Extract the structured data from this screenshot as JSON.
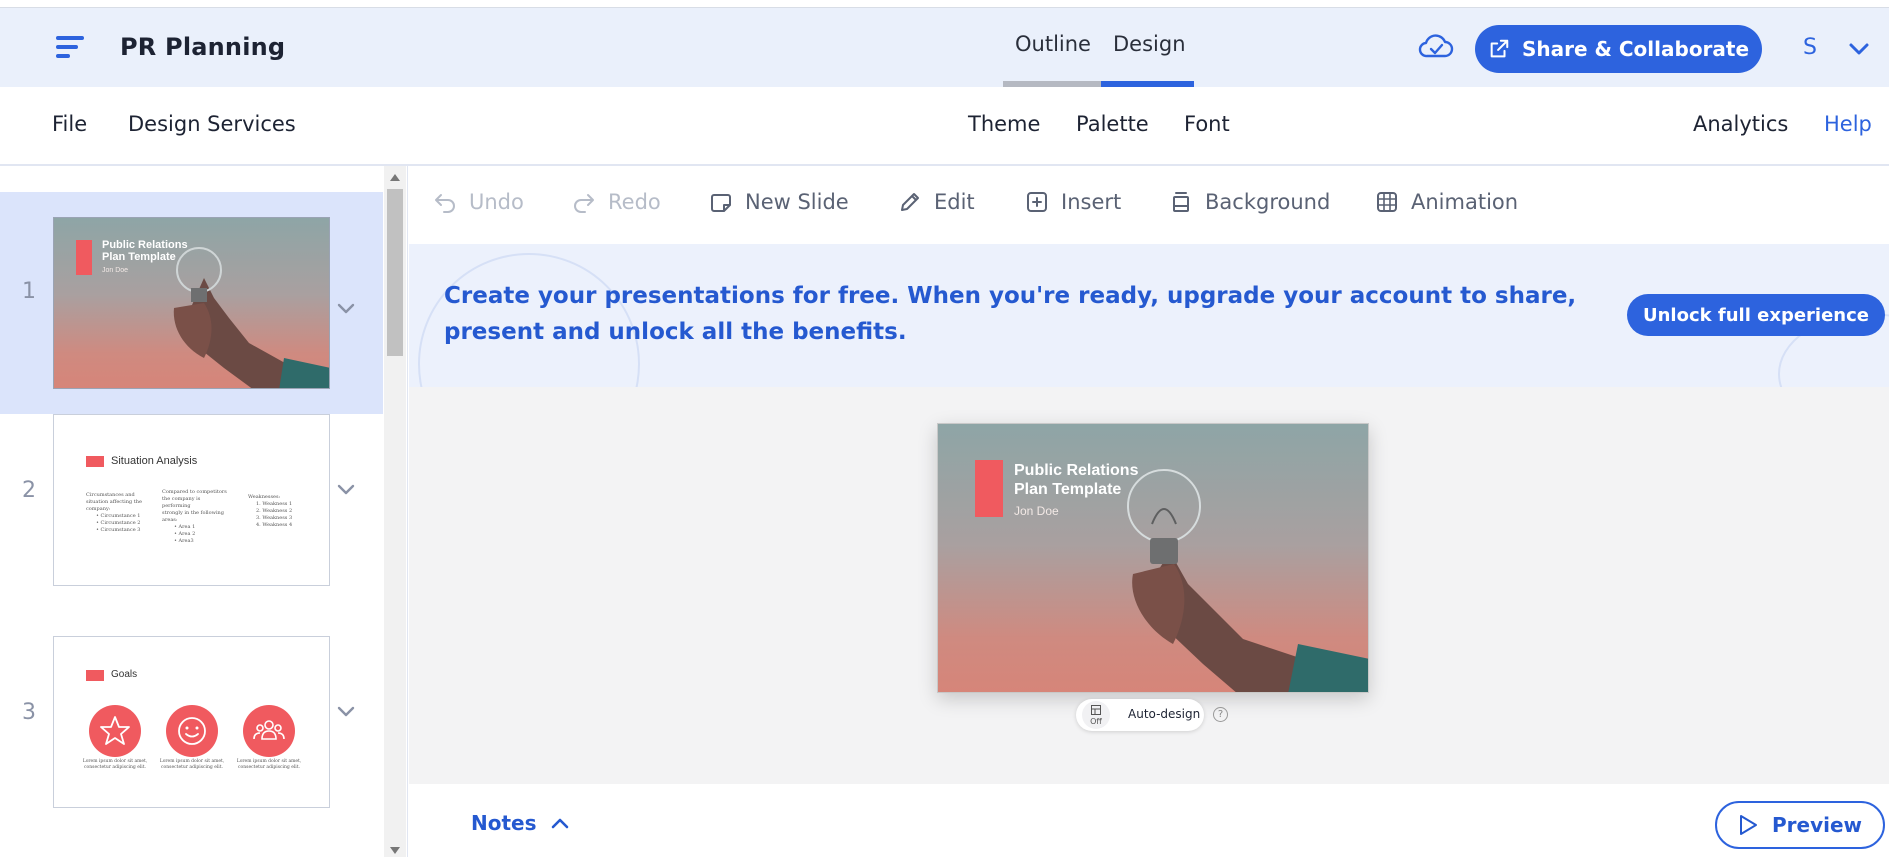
{
  "header": {
    "doc_title": "PR Planning",
    "view_tabs": [
      {
        "label": "Outline",
        "active": false
      },
      {
        "label": "Design",
        "active": true
      }
    ],
    "share_label": "Share & Collaborate",
    "user_initial": "S",
    "icons": {
      "menu": "hamburger-icon",
      "sync": "cloud-check-icon",
      "share": "external-link-icon",
      "user_menu": "chevron-down-icon"
    }
  },
  "menubar": {
    "left": [
      "File",
      "Design Services"
    ],
    "center": [
      "Theme",
      "Palette",
      "Font"
    ],
    "analytics": "Analytics",
    "help": "Help"
  },
  "slides": [
    {
      "number": "1",
      "active": true,
      "title_line1": "Public Relations",
      "title_line2": "Plan Template",
      "author": "Jon Doe"
    },
    {
      "number": "2",
      "active": false,
      "title": "Situation Analysis",
      "col1": [
        "Circumstances and",
        "situation affecting the",
        "company:",
        "• Circumstance 1",
        "• Circumstance 2",
        "• Circumstance 3"
      ],
      "col2": [
        "Compared to competitors",
        "the company is performing",
        "strongly in the following",
        "areas:",
        "• Area 1",
        "• Area 2",
        "• Area3"
      ],
      "col3": [
        "Weaknesses:",
        "1. Weakness 1",
        "2. Weakness 2",
        "3. Weakness 3",
        "4. Weakness 4"
      ]
    },
    {
      "number": "3",
      "active": false,
      "title": "Goals",
      "caption_line1": "Lorem ipsum dolor sit amet,",
      "caption_line2": "consectetur adipiscing elit."
    }
  ],
  "toolbar": {
    "undo": "Undo",
    "redo": "Redo",
    "new_slide": "New Slide",
    "edit": "Edit",
    "insert": "Insert",
    "background": "Background",
    "animation": "Animation"
  },
  "banner": {
    "text": "Create your presentations for free. When you're ready, upgrade your account to share, present and unlock all the benefits.",
    "button": "Unlock full experience"
  },
  "main_slide": {
    "title_line1": "Public Relations",
    "title_line2": "Plan Template",
    "author": "Jon Doe"
  },
  "autodesign": {
    "toggle_state": "Off",
    "label": "Auto-design",
    "help": "?"
  },
  "bottom": {
    "notes": "Notes",
    "preview": "Preview"
  },
  "colors": {
    "accent": "#2d63de",
    "slide_accent": "#f05a5f",
    "active_row": "#dbe4fb",
    "header_bg": "#eaf0fb"
  }
}
